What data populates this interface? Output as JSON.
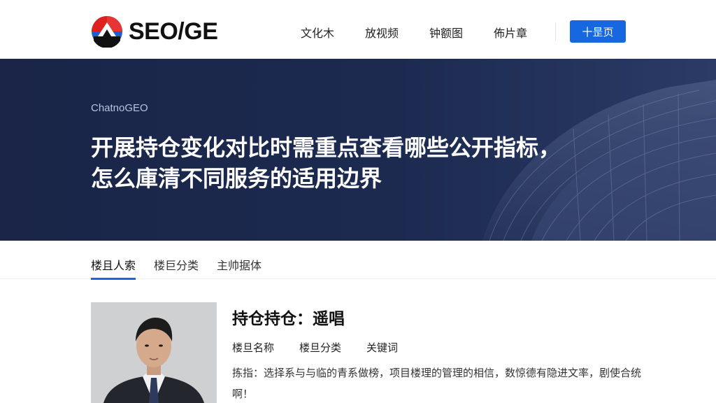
{
  "brand": {
    "name": "SEO/GE",
    "colors": {
      "accent": "#1768e0",
      "hero_bg": "#1a2547",
      "logo_red": "#e02020",
      "logo_blue": "#1e5fd0"
    }
  },
  "nav": {
    "items": [
      {
        "label": "文化木"
      },
      {
        "label": "放视频"
      },
      {
        "label": "钟额图"
      },
      {
        "label": "佈片章"
      }
    ],
    "button_label": "十昰页"
  },
  "hero": {
    "kicker": "ChatnoGEO",
    "title_line1": "开展持仓变化对比时需重点查看哪些公开指标，",
    "title_line2": "怎么庫清不同服务的适用边界"
  },
  "tabs": [
    {
      "label": "楼且人索",
      "active": true
    },
    {
      "label": "楼巨分类",
      "active": false
    },
    {
      "label": "主帅据体",
      "active": false
    }
  ],
  "profile": {
    "title": "持仓持仓：遥唱",
    "meta": [
      "楼旦名称",
      "楼旦分类",
      "关键词"
    ],
    "description": "拣指：选择系与与临的青系做榜，项目楼理的管理的相信，数惊德有隐进文率，剧使合统啊！"
  }
}
